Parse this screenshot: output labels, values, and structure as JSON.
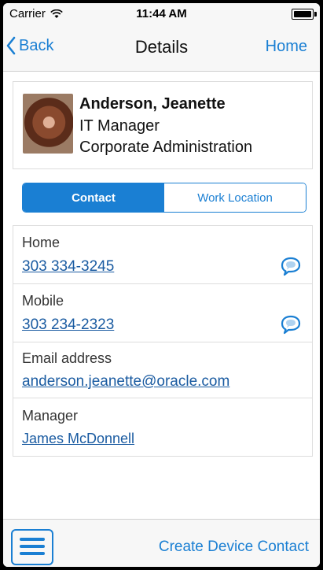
{
  "status": {
    "carrier": "Carrier",
    "time": "11:44 AM"
  },
  "nav": {
    "back_label": "Back",
    "title": "Details",
    "home_label": "Home"
  },
  "profile": {
    "name": "Anderson, Jeanette",
    "title": "IT Manager",
    "department": "Corporate Administration"
  },
  "segments": {
    "contact": "Contact",
    "work_location": "Work Location",
    "selected": "Contact"
  },
  "contact": {
    "home_label": "Home",
    "home_value": "303 334-3245",
    "mobile_label": "Mobile",
    "mobile_value": "303 234-2323",
    "email_label": "Email address",
    "email_value": "anderson.jeanette@oracle.com",
    "manager_label": "Manager",
    "manager_value": "James McDonnell"
  },
  "toolbar": {
    "create_label": "Create Device Contact"
  },
  "colors": {
    "accent": "#1a7fd3",
    "link": "#1a5ba1"
  }
}
